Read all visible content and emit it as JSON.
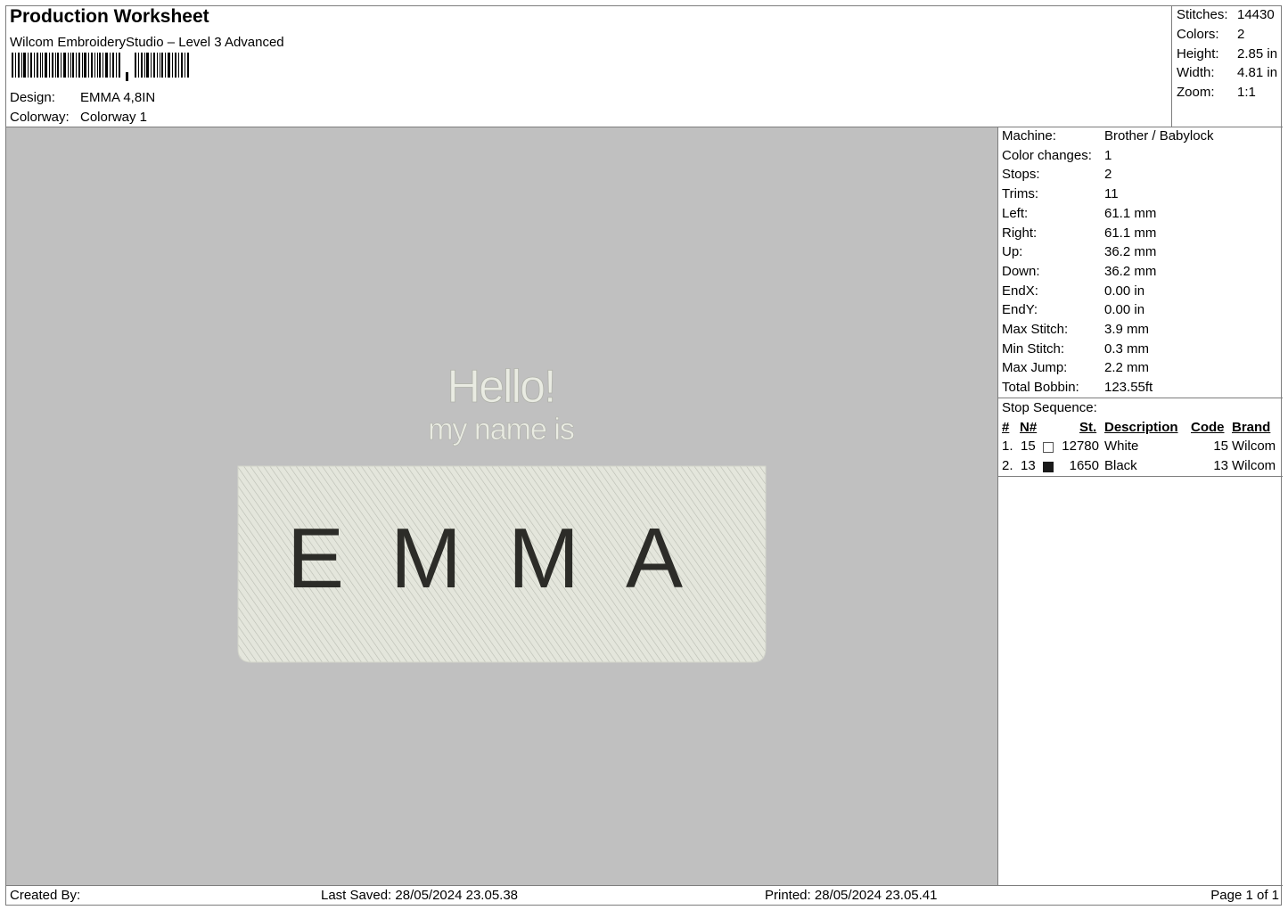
{
  "header": {
    "title": "Production Worksheet",
    "subtitle": "Wilcom EmbroideryStudio – Level 3 Advanced",
    "design_label": "Design:",
    "design_value": "EMMA 4,8IN",
    "colorway_label": "Colorway:",
    "colorway_value": "Colorway 1"
  },
  "summary": {
    "stitches_label": "Stitches:",
    "stitches_value": "14430",
    "colors_label": "Colors:",
    "colors_value": "2",
    "height_label": "Height:",
    "height_value": "2.85 in",
    "width_label": "Width:",
    "width_value": "4.81 in",
    "zoom_label": "Zoom:",
    "zoom_value": "1:1"
  },
  "design_preview": {
    "hello": "Hello!",
    "my_name_is": "my name is",
    "name": "EMMA",
    "background_color": "#c0c0c0",
    "patch_color": "#e4e6dc",
    "text_white": "#e9ebe2",
    "text_black": "#2c2c28"
  },
  "machine_info": [
    {
      "label": "Machine:",
      "value": "Brother / Babylock"
    },
    {
      "label": "Color changes:",
      "value": "1"
    },
    {
      "label": "Stops:",
      "value": "2"
    },
    {
      "label": "Trims:",
      "value": "11"
    },
    {
      "label": "Left:",
      "value": "61.1 mm"
    },
    {
      "label": "Right:",
      "value": "61.1 mm"
    },
    {
      "label": "Up:",
      "value": "36.2 mm"
    },
    {
      "label": "Down:",
      "value": "36.2 mm"
    },
    {
      "label": "EndX:",
      "value": "0.00 in"
    },
    {
      "label": "EndY:",
      "value": "0.00 in"
    },
    {
      "label": "Max Stitch:",
      "value": "3.9 mm"
    },
    {
      "label": "Min Stitch:",
      "value": "0.3 mm"
    },
    {
      "label": "Max Jump:",
      "value": "2.2 mm"
    },
    {
      "label": "Total Bobbin:",
      "value": "123.55ft"
    }
  ],
  "stop_sequence": {
    "label": "Stop Sequence:",
    "columns": [
      "#",
      "N#",
      "St.",
      "Description",
      "Code",
      "Brand"
    ],
    "rows": [
      {
        "num": "1.",
        "n": "15",
        "swatch": "#ffffff",
        "st": "12780",
        "description": "White",
        "code": "15",
        "brand": "Wilcom"
      },
      {
        "num": "2.",
        "n": "13",
        "swatch": "#1a1a1a",
        "st": "1650",
        "description": "Black",
        "code": "13",
        "brand": "Wilcom"
      }
    ]
  },
  "footer": {
    "created_by": "Created By:",
    "last_saved": "Last Saved: 28/05/2024 23.05.38",
    "printed": "Printed: 28/05/2024 23.05.41",
    "page": "Page 1 of 1"
  }
}
